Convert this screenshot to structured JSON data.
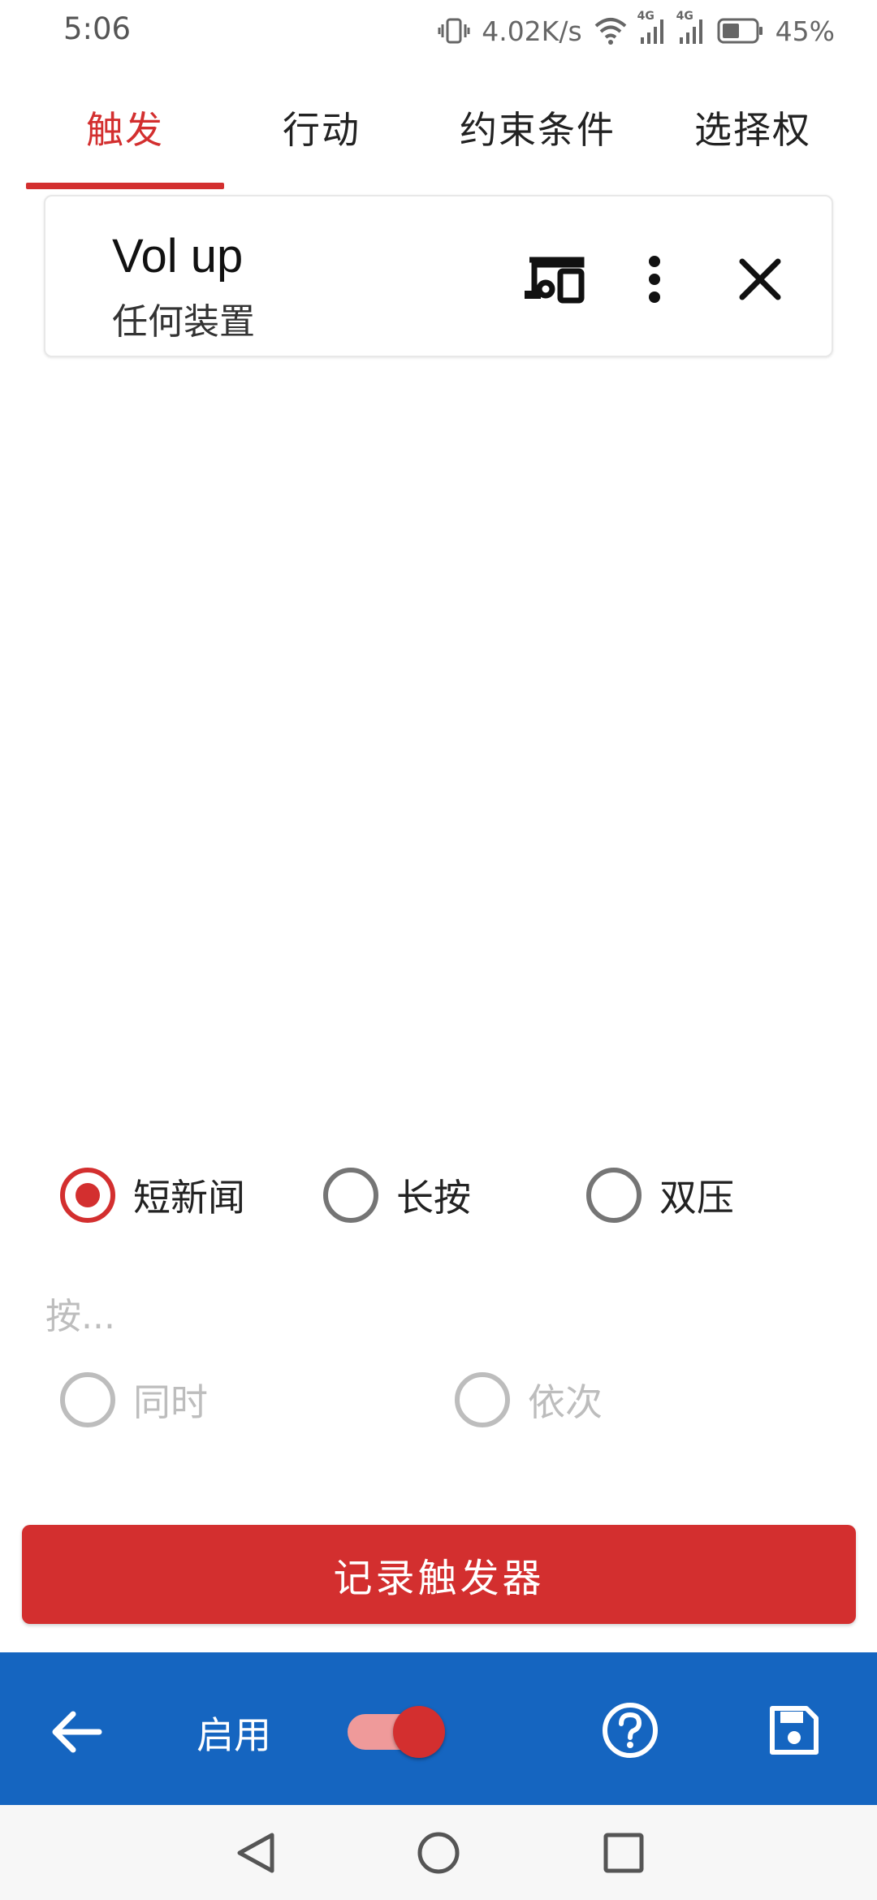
{
  "status_bar": {
    "time": "5:06",
    "net_speed": "4.02K/s",
    "battery": "45%",
    "net_type_1": "4G",
    "net_type_2": "4G"
  },
  "tabs": [
    {
      "label": "触发"
    },
    {
      "label": "行动"
    },
    {
      "label": "约束条件"
    },
    {
      "label": "选择权"
    }
  ],
  "trigger_card": {
    "title": "Vol up",
    "subtitle": "任何装置"
  },
  "press_type": {
    "options": [
      {
        "label": "短新闻",
        "checked": true
      },
      {
        "label": "长按",
        "checked": false
      },
      {
        "label": "双压",
        "checked": false
      }
    ]
  },
  "press_order": {
    "label": "按...",
    "options": [
      {
        "label": "同时"
      },
      {
        "label": "依次"
      }
    ]
  },
  "record_button": "记录触发器",
  "app_bar": {
    "enable_label": "启用",
    "toggle_on": true
  },
  "colors": {
    "accent": "#d32f2f",
    "app_bar": "#1565c0"
  }
}
